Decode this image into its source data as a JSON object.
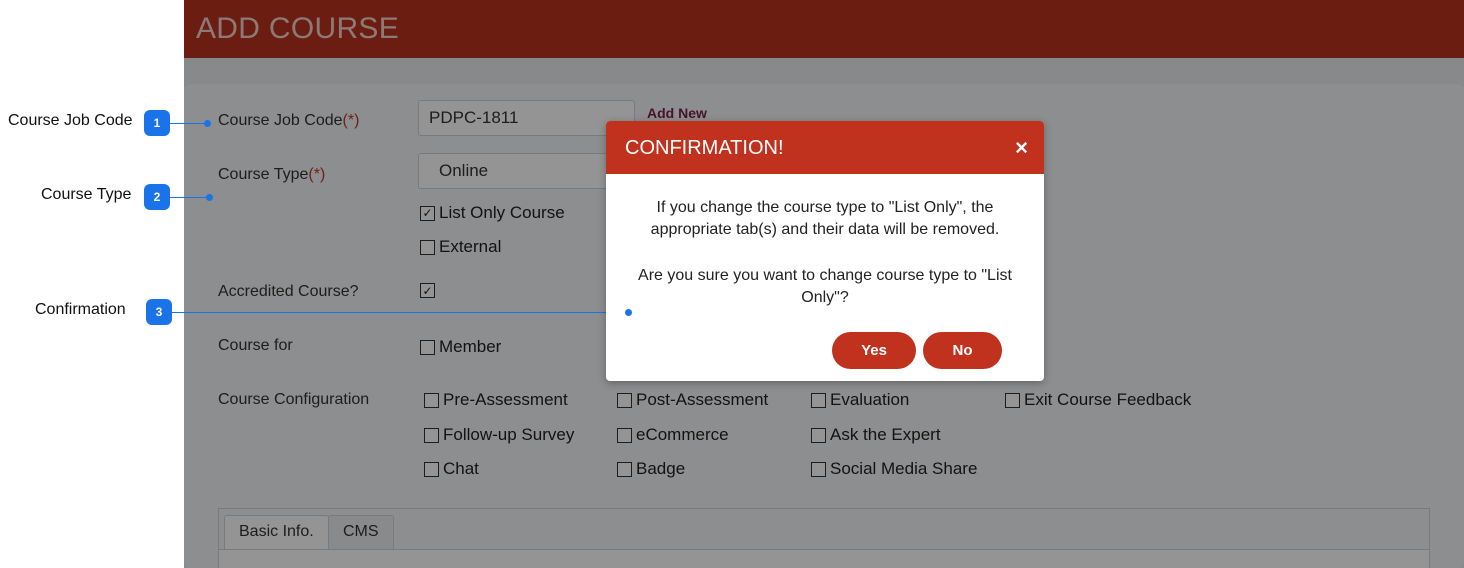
{
  "annotations": [
    {
      "num": "1",
      "label": "Course Job Code"
    },
    {
      "num": "2",
      "label": "Course Type"
    },
    {
      "num": "3",
      "label": "Confirmation"
    }
  ],
  "header": {
    "title": "ADD COURSE"
  },
  "form": {
    "job_code": {
      "label": "Course Job Code",
      "required": "(*)",
      "value": "PDPC-1811",
      "add_new": "Add New"
    },
    "course_type": {
      "label": "Course Type",
      "required": "(*)",
      "selected": "Online",
      "list_only": "List Only Course",
      "external": "External"
    },
    "accredited": {
      "label": "Accredited Course?"
    },
    "course_for": {
      "label": "Course for",
      "member": "Member"
    },
    "config": {
      "label": "Course Configuration",
      "options": [
        "Pre-Assessment",
        "Post-Assessment",
        "Evaluation",
        "Exit Course Feedback",
        "Follow-up Survey",
        "eCommerce",
        "Ask the Expert",
        "Chat",
        "Badge",
        "Social Media Share"
      ]
    }
  },
  "tabs": [
    "Basic Info.",
    "CMS"
  ],
  "modal": {
    "title": "CONFIRMATION!",
    "close": "×",
    "message1": "If you change the course type to \"List Only\", the appropriate tab(s) and their data will be removed.",
    "message2": "Are you sure you want to change course type to \"List Only\"?",
    "yes": "Yes",
    "no": "No"
  },
  "glyphs": {
    "check": "✓"
  },
  "colors": {
    "accent": "#1a73e8",
    "header": "#b83220",
    "modal_header": "#c0311e"
  }
}
